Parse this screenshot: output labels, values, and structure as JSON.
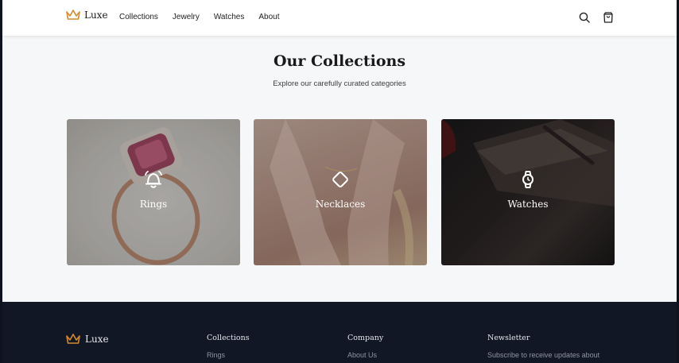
{
  "brand": {
    "name": "Luxe",
    "accent": "#d48a2e"
  },
  "nav": {
    "items": [
      "Collections",
      "Jewelry",
      "Watches",
      "About"
    ]
  },
  "header_icons": [
    "search-icon",
    "shopping-bag-icon"
  ],
  "section": {
    "title": "Our Collections",
    "subtitle": "Explore our carefully curated categories"
  },
  "cards": [
    {
      "label": "Rings",
      "icon": "bell-icon"
    },
    {
      "label": "Necklaces",
      "icon": "diamond-icon"
    },
    {
      "label": "Watches",
      "icon": "watch-icon"
    }
  ],
  "footer": {
    "brand": "Luxe",
    "columns": [
      {
        "heading": "Collections",
        "first_link": "Rings"
      },
      {
        "heading": "Company",
        "first_link": "About Us"
      },
      {
        "heading": "Newsletter",
        "first_link": "Subscribe to receive updates about"
      }
    ]
  }
}
